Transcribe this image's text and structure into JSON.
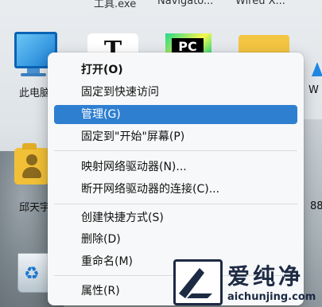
{
  "desktop": {
    "top_labels": [
      "工具.exe",
      "Navigato...",
      "Wireu X..."
    ],
    "icons": {
      "this_pc_label": "此电脑",
      "typora_glyph": "T",
      "pycharm_glyph": "PC",
      "user_folder_label": "邱天宇",
      "right_label_1": "W",
      "right_label_2": "88"
    }
  },
  "context_menu": {
    "items": [
      {
        "label": "打开(O)",
        "bold": true
      },
      {
        "label": "固定到快速访问"
      },
      {
        "label": "管理(G)",
        "highlighted": true
      },
      {
        "label": "固定到\"开始\"屏幕(P)"
      },
      {
        "label": "映射网络驱动器(N)..."
      },
      {
        "label": "断开网络驱动器的连接(C)..."
      },
      {
        "label": "创建快捷方式(S)"
      },
      {
        "label": "删除(D)"
      },
      {
        "label": "重命名(M)"
      },
      {
        "label": "属性(R)"
      }
    ]
  },
  "watermark": {
    "title": "爱纯净",
    "url": "aichunjing.com"
  },
  "colors": {
    "menu_highlight": "#2f7fd1",
    "menu_background": "#f7f8f9",
    "watermark": "#1d2a44"
  }
}
